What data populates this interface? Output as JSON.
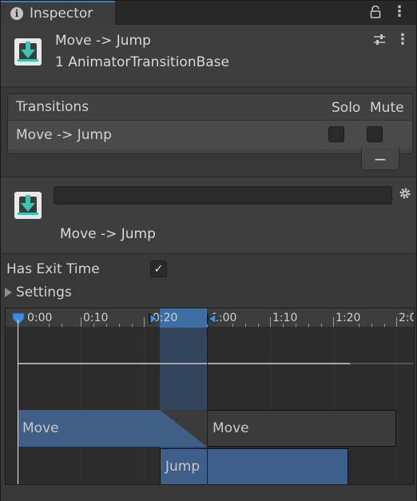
{
  "tab": {
    "title": "Inspector"
  },
  "header": {
    "title": "Move -> Jump",
    "subtitle": "1 AnimatorTransitionBase"
  },
  "transitions": {
    "header_label": "Transitions",
    "solo_label": "Solo",
    "mute_label": "Mute",
    "rows": [
      {
        "label": "Move -> Jump",
        "solo": false,
        "mute": false
      }
    ],
    "remove_label": "−"
  },
  "detail": {
    "name_value": "",
    "label": "Move -> Jump"
  },
  "settings": {
    "has_exit_time_label": "Has Exit Time",
    "has_exit_time_checked": true,
    "checkmark": "✓",
    "foldout_label": "Settings"
  },
  "timeline": {
    "ticks": [
      "0:00",
      "0:10",
      "0:20",
      "1:00",
      "1:10",
      "1:20",
      "2:0"
    ],
    "source_state": "Move",
    "destination_state": "Jump"
  },
  "colors": {
    "accent": "#3a79bb",
    "source_block": "#3f5f86",
    "dest_block": "#3d5f8a",
    "highlight": "#3e6ea3"
  }
}
